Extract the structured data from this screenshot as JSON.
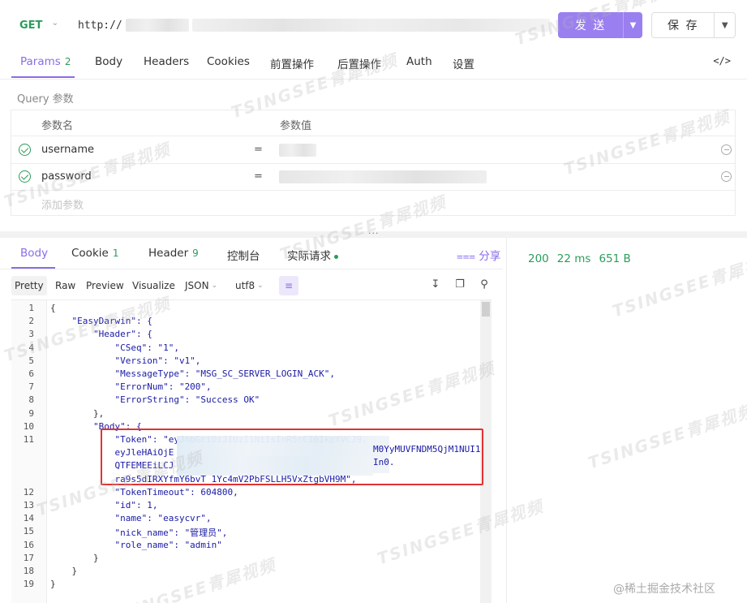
{
  "request": {
    "method": "GET",
    "url_prefix": "http://",
    "send_label": "发 送",
    "save_label": "保 存"
  },
  "req_tabs": [
    {
      "label": "Params",
      "count": "2"
    },
    {
      "label": "Body"
    },
    {
      "label": "Headers"
    },
    {
      "label": "Cookies"
    },
    {
      "label": "前置操作"
    },
    {
      "label": "后置操作"
    },
    {
      "label": "Auth"
    },
    {
      "label": "设置"
    }
  ],
  "code_icon": "</>",
  "query": {
    "title": "Query 参数",
    "col_name": "参数名",
    "col_value": "参数值",
    "rows": [
      {
        "key": "username",
        "eq": "="
      },
      {
        "key": "password",
        "eq": "="
      }
    ],
    "add_placeholder": "添加参数"
  },
  "res_tabs": [
    {
      "label": "Body"
    },
    {
      "label": "Cookie",
      "count": "1"
    },
    {
      "label": "Header",
      "count": "9"
    },
    {
      "label": "控制台"
    },
    {
      "label": "实际请求"
    }
  ],
  "share_label": "分享",
  "status": {
    "code": "200",
    "time": "22 ms",
    "size": "651 B"
  },
  "formats": [
    "Pretty",
    "Raw",
    "Preview",
    "Visualize"
  ],
  "content_type": "JSON",
  "encoding": "utf8",
  "code_lines": [
    {
      "n": "1",
      "t": "{"
    },
    {
      "n": "2",
      "t": "    \"EasyDarwin\": {"
    },
    {
      "n": "3",
      "t": "        \"Header\": {"
    },
    {
      "n": "4",
      "t": "            \"CSeq\": \"1\","
    },
    {
      "n": "5",
      "t": "            \"Version\": \"v1\","
    },
    {
      "n": "6",
      "t": "            \"MessageType\": \"MSG_SC_SERVER_LOGIN_ACK\","
    },
    {
      "n": "7",
      "t": "            \"ErrorNum\": \"200\","
    },
    {
      "n": "8",
      "t": "            \"ErrorString\": \"Success OK\""
    },
    {
      "n": "9",
      "t": "        },"
    },
    {
      "n": "10",
      "t": "        \"Body\": {"
    },
    {
      "n": "11",
      "t": "            \"Token\": \"eyJhbGciOiJIUzI1NiIsInR5cCI6IkpXVCJ9."
    },
    {
      "n": "",
      "t": "            eyJleHAiOjE"
    },
    {
      "n": "",
      "t": "            QTFEMEEiLCJ"
    },
    {
      "n": "",
      "t": "            ra9s5dIRXYfmY6bvT_1Yc4mV2PbFSLLH5VxZtgbVH9M\","
    },
    {
      "n": "12",
      "t": "            \"TokenTimeout\": 604800,"
    },
    {
      "n": "13",
      "t": "            \"id\": 1,"
    },
    {
      "n": "14",
      "t": "            \"name\": \"easycvr\","
    },
    {
      "n": "15",
      "t": "            \"nick_name\": \"管理员\","
    },
    {
      "n": "16",
      "t": "            \"role_name\": \"admin\""
    },
    {
      "n": "17",
      "t": "        }"
    },
    {
      "n": "18",
      "t": "    }"
    },
    {
      "n": "19",
      "t": "}"
    }
  ],
  "token_tail_1": "M0YyMUVFNDM5QjM1NUI1",
  "token_tail_2": "In0.",
  "watermark_text": "TSINGSEE青犀视频",
  "credit": "@稀土掘金技术社区"
}
